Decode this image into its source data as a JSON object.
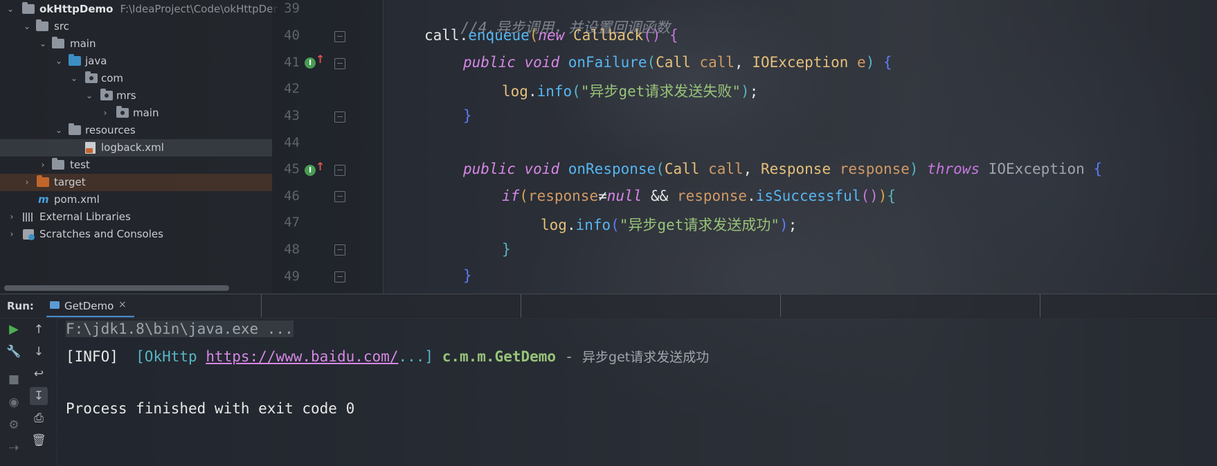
{
  "project": {
    "root_name": "okHttpDemo",
    "root_path": "F:\\IdeaProject\\Code\\okHttpDer",
    "items": [
      {
        "label": "src"
      },
      {
        "label": "main"
      },
      {
        "label": "java"
      },
      {
        "label": "com"
      },
      {
        "label": "mrs"
      },
      {
        "label": "main"
      },
      {
        "label": "resources"
      },
      {
        "label": "logback.xml"
      },
      {
        "label": "test"
      },
      {
        "label": "target"
      },
      {
        "label": "pom.xml"
      },
      {
        "label": "External Libraries"
      },
      {
        "label": "Scratches and Consoles"
      }
    ]
  },
  "editor": {
    "line_numbers": [
      "39",
      "40",
      "41",
      "42",
      "43",
      "44",
      "45",
      "46",
      "47",
      "48",
      "49"
    ],
    "code": {
      "l39_comment": "//4.异步调用，并设置回调函数",
      "call": "call",
      "dot": ".",
      "enqueue": "enqueue",
      "paren_open": "(",
      "new_kw": "new",
      "callback_type": "Callback",
      "empty_parens": "()",
      "brace_open": "{",
      "public_kw": "public",
      "void_kw": "void",
      "onFailure": "onFailure",
      "Call_type": "Call",
      "call_param": "call",
      "comma": ", ",
      "IOException": "IOException",
      "e_param": "e",
      "paren_close": ")",
      "log": "log",
      "info": "info",
      "fail_msg": "\"异步get请求发送失败\"",
      "semicolon": ";",
      "brace_close": "}",
      "onResponse": "onResponse",
      "Response_type": "Response",
      "response_param": "response",
      "throws_kw": "throws",
      "if_kw": "if",
      "neq": "≠",
      "null_kw": "null",
      "and": " && ",
      "isSuccessful": "isSuccessful",
      "success_msg": "\"异步get请求发送成功\""
    }
  },
  "run": {
    "label": "Run:",
    "tab": "GetDemo",
    "tab_close": "×"
  },
  "console": {
    "cmd_line": "F:\\jdk1.8\\bin\\java.exe ...",
    "info_tag": "[INFO]",
    "bracket_open": "[OkHttp ",
    "url": "https://www.baidu.com/",
    "bracket_close": "...]",
    "logger": "c.m.m.GetDemo",
    "dash": " - ",
    "message": "异步get请求发送成功",
    "exit_line": "Process finished with exit code 0"
  }
}
